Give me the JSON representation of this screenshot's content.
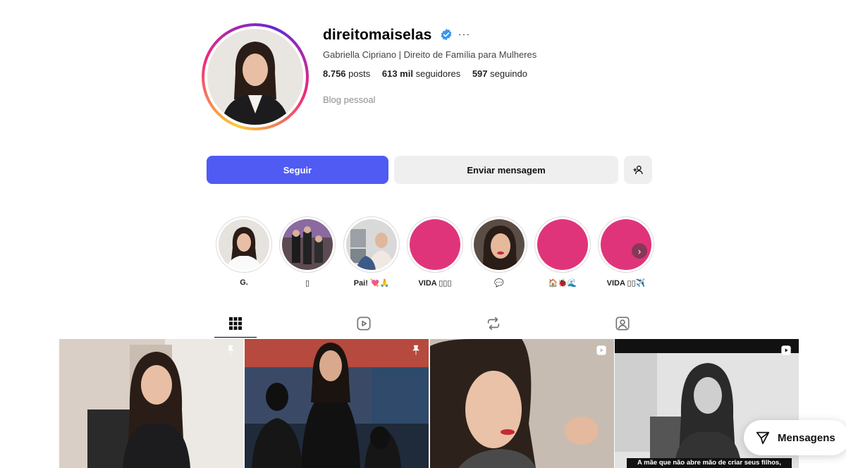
{
  "profile": {
    "username": "direitomaiselas",
    "more_label": "···",
    "full_name": "Gabriella Cipriano | Direito de Família para Mulheres",
    "stats": {
      "posts_value": "8.756",
      "posts_label": "posts",
      "followers_value": "613 mil",
      "followers_label": "seguidores",
      "following_value": "597",
      "following_label": "seguindo"
    },
    "category": "Blog pessoal"
  },
  "actions": {
    "follow_label": "Seguir",
    "message_label": "Enviar mensagem"
  },
  "highlights": [
    {
      "label": "G."
    },
    {
      "label": "▯"
    },
    {
      "label": "Pai! 💘🙏"
    },
    {
      "label": "VIDA ▯▯▯"
    },
    {
      "label": "💬"
    },
    {
      "label": "🏠🐞🌊"
    },
    {
      "label": "VIDA ▯▯✈️"
    }
  ],
  "tabs": [
    {
      "icon": "grid-icon",
      "active": true
    },
    {
      "icon": "reels-icon",
      "active": false
    },
    {
      "icon": "repost-icon",
      "active": false
    },
    {
      "icon": "tagged-icon",
      "active": false
    }
  ],
  "posts": [
    {
      "badge": "pin-icon"
    },
    {
      "badge": "pin-icon"
    },
    {
      "badge": "reel-icon"
    },
    {
      "badge": "reel-icon",
      "caption": "A mãe que não abre mão de criar seus filhos,"
    }
  ],
  "messages": {
    "label": "Mensagens"
  },
  "colors": {
    "accent": "#4f5bf3",
    "verified": "#3897f0",
    "highlight_pink": "#e0347a"
  }
}
